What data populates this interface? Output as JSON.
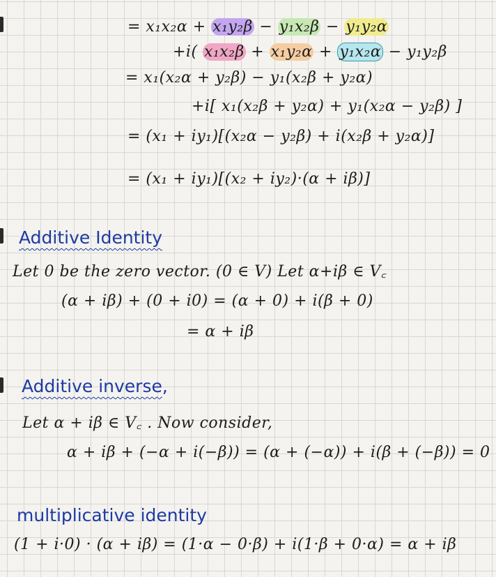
{
  "colors": {
    "ink": "#1c1c1c",
    "heading_blue": "#1d3aa3",
    "highlight_purple": "#c3a6ef",
    "highlight_green": "#c7e8b4",
    "highlight_yellow": "#f0ec8e",
    "highlight_pink": "#f0a6c4",
    "highlight_orange": "#f5cda2",
    "highlight_cyan": "#b6e6ee"
  },
  "derivation": {
    "line1": {
      "prefix": "= x₁x₂α + ",
      "p1": "x₁y₂β",
      "sep1": " − ",
      "p2": "y₁x₂β",
      "sep2": " − ",
      "p3": "y₁y₂α"
    },
    "line2": {
      "prefix": "+i( ",
      "p1": "x₁x₂β",
      "sep1": " + ",
      "p2": "x₁y₂α",
      "sep2": " + ",
      "p3": "y₁x₂α",
      "suffix": " − y₁y₂β"
    },
    "line3": "= x₁(x₂α + y₂β) − y₁(x₂β + y₂α)",
    "line4": "+i[ x₁(x₂β + y₂α) + y₁(x₂α − y₂β) ]",
    "line5": "= (x₁ + iy₁)[(x₂α − y₂β) + i(x₂β + y₂α)]",
    "line6": "= (x₁ + iy₁)[(x₂ + iy₂)·(α + iβ)]"
  },
  "additive_identity": {
    "heading": "Additive Identity",
    "line1": "Let 0 be the zero vector. (0 ∈ V)  Let α+iβ ∈ V꜀",
    "line2": "(α + iβ) + (0 + i0) = (α + 0) + i(β + 0)",
    "line3": "= α + iβ"
  },
  "additive_inverse": {
    "heading": "Additive inverse",
    "comma": ",",
    "line1": "Let  α + iβ ∈ V꜀ .  Now consider,",
    "line2": "α + iβ + (−α + i(−β)) = (α + (−α)) + i(β + (−β)) = 0"
  },
  "multiplicative_identity": {
    "heading": "multiplicative identity",
    "line1": "(1 + i·0) · (α + iβ) = (1·α − 0·β) + i(1·β + 0·α) = α + iβ"
  }
}
